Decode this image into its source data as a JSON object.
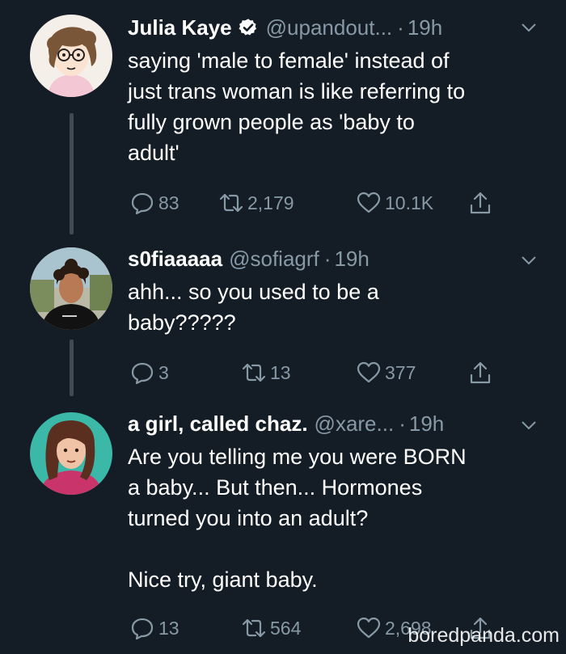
{
  "colors": {
    "background": "#141d26",
    "primary_text": "#ffffff",
    "secondary_text": "#8899a6",
    "thread_line": "#3f4a55"
  },
  "tweets": [
    {
      "name": "Julia Kaye",
      "verified": true,
      "handle": "@upandout...",
      "dot": "·",
      "time": "19h",
      "text": "saying 'male to female' instead of\njust trans woman is like referring to\nfully grown people as 'baby to\nadult'",
      "reply_count": "83",
      "retweet_count": "2,179",
      "like_count": "10.1K",
      "avatar_icon": "cartoon-avatar"
    },
    {
      "name": "s0fiaaaaa",
      "verified": false,
      "handle": "@sofiagrf",
      "dot": "·",
      "time": "19h",
      "text": "ahh... so you used to be a\nbaby?????",
      "reply_count": "3",
      "retweet_count": "13",
      "like_count": "377",
      "avatar_icon": "photo-avatar"
    },
    {
      "name": "a girl, called chaz.",
      "verified": false,
      "handle": "@xare...",
      "dot": "·",
      "time": "19h",
      "text": "Are you telling me you were BORN\na baby... But then... Hormones\nturned you into an adult?\n\nNice try, giant baby.",
      "reply_count": "13",
      "retweet_count": "564",
      "like_count": "2,698",
      "avatar_icon": "illustrated-avatar"
    }
  ],
  "watermark": "boredpanda.com"
}
